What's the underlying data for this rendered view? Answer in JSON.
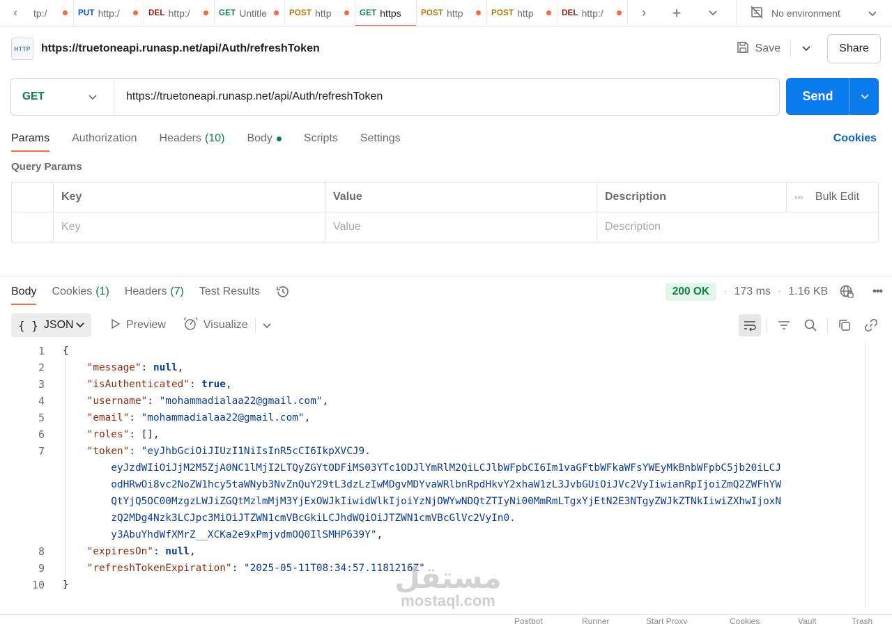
{
  "tabbar": {
    "tabs": [
      {
        "method": "",
        "title": "tp:/",
        "active": false
      },
      {
        "method": "PUT",
        "title": "http:/",
        "active": false
      },
      {
        "method": "DEL",
        "title": "http:/",
        "active": false
      },
      {
        "method": "GET",
        "title": "Untitle",
        "active": false
      },
      {
        "method": "POST",
        "title": "http",
        "active": false
      },
      {
        "method": "GET",
        "title": "https",
        "active": true
      },
      {
        "method": "POST",
        "title": "http",
        "active": false
      },
      {
        "method": "POST",
        "title": "http",
        "active": false
      },
      {
        "method": "DEL",
        "title": "http:/",
        "active": false
      }
    ],
    "environment": "No environment"
  },
  "request": {
    "title": "https://truetoneapi.runasp.net/api/Auth/refreshToken",
    "badge": "HTTP",
    "save_label": "Save",
    "share_label": "Share",
    "method": "GET",
    "url": "https://truetoneapi.runasp.net/api/Auth/refreshToken",
    "send_label": "Send",
    "tabs": {
      "params": "Params",
      "authorization": "Authorization",
      "headers": "Headers",
      "headers_count": "(10)",
      "body": "Body",
      "scripts": "Scripts",
      "settings": "Settings"
    },
    "cookies_label": "Cookies"
  },
  "query_params": {
    "title": "Query Params",
    "headers": {
      "key": "Key",
      "value": "Value",
      "description": "Description",
      "bulk_edit": "Bulk Edit"
    },
    "placeholders": {
      "key": "Key",
      "value": "Value",
      "description": "Description"
    }
  },
  "response": {
    "tabs": {
      "body": "Body",
      "cookies": "Cookies",
      "cookies_count": "(1)",
      "headers": "Headers",
      "headers_count": "(7)",
      "test_results": "Test Results"
    },
    "status": "200 OK",
    "time": "173 ms",
    "size": "1.16 KB",
    "format": "JSON",
    "preview_label": "Preview",
    "visualize_label": "Visualize",
    "lines": [
      {
        "n": "1",
        "parts": [
          [
            "pun",
            "{"
          ]
        ]
      },
      {
        "n": "2",
        "parts": [
          [
            "pun",
            "    "
          ],
          [
            "key",
            "\"message\""
          ],
          [
            "pun",
            ": "
          ],
          [
            "lit",
            "null"
          ],
          [
            "pun",
            ","
          ]
        ]
      },
      {
        "n": "3",
        "parts": [
          [
            "pun",
            "    "
          ],
          [
            "key",
            "\"isAuthenticated\""
          ],
          [
            "pun",
            ": "
          ],
          [
            "lit",
            "true"
          ],
          [
            "pun",
            ","
          ]
        ]
      },
      {
        "n": "4",
        "parts": [
          [
            "pun",
            "    "
          ],
          [
            "key",
            "\"username\""
          ],
          [
            "pun",
            ": "
          ],
          [
            "str",
            "\"mohammadialaa22@gmail.com\""
          ],
          [
            "pun",
            ","
          ]
        ]
      },
      {
        "n": "5",
        "parts": [
          [
            "pun",
            "    "
          ],
          [
            "key",
            "\"email\""
          ],
          [
            "pun",
            ": "
          ],
          [
            "str",
            "\"mohammadialaa22@gmail.com\""
          ],
          [
            "pun",
            ","
          ]
        ]
      },
      {
        "n": "6",
        "parts": [
          [
            "pun",
            "    "
          ],
          [
            "key",
            "\"roles\""
          ],
          [
            "pun",
            ": [],"
          ]
        ]
      },
      {
        "n": "7",
        "parts": [
          [
            "pun",
            "    "
          ],
          [
            "key",
            "\"token\""
          ],
          [
            "pun",
            ": "
          ],
          [
            "str",
            "\"eyJhbGciOiJIUzI1NiIsInR5cCI6IkpXVCJ9."
          ]
        ]
      },
      {
        "n": "",
        "parts": [
          [
            "str",
            "        eyJzdWIiOiJjM2M5ZjA0NC1lMjI2LTQyZGYtODFiMS03YTc1ODJlYmRlM2QiLCJlbWFpbCI6Im1vaGFtbWFkaWFsYWEyMkBnbWFpbC5jb20iLCJ"
          ]
        ]
      },
      {
        "n": "",
        "parts": [
          [
            "str",
            "        odHRwOi8vc2NoZW1hcy5taWNyb3NvZnQuY29tL3dzLzIwMDgvMDYvaWRlbnRpdHkvY2xhaW1zL3JvbGUiOiJVc2VyIiwianRpIjoiZmQ2ZWFhYW"
          ]
        ]
      },
      {
        "n": "",
        "parts": [
          [
            "str",
            "        QtYjQ5OC00MzgzLWJiZGQtMzlmMjM3YjExOWJkIiwidWlkIjoiYzNjOWYwNDQtZTIyNi00MmRmLTgxYjEtN2E3NTgyZWJkZTNkIiwiZXhwIjoxN"
          ]
        ]
      },
      {
        "n": "",
        "parts": [
          [
            "str",
            "        zQ2MDg4Nzk3LCJpc3MiOiJTZWN1cmVBcGkiLCJhdWQiOiJTZWN1cmVBcGlVc2VyIn0."
          ]
        ]
      },
      {
        "n": "",
        "parts": [
          [
            "str",
            "        y3AbuYhdWfXMrZ__XCKa2e9xPmjvdmOQ0IlSMHP639Y\""
          ],
          [
            "pun",
            ","
          ]
        ]
      },
      {
        "n": "8",
        "parts": [
          [
            "pun",
            "    "
          ],
          [
            "key",
            "\"expiresOn\""
          ],
          [
            "pun",
            ": "
          ],
          [
            "lit",
            "null"
          ],
          [
            "pun",
            ","
          ]
        ]
      },
      {
        "n": "9",
        "parts": [
          [
            "pun",
            "    "
          ],
          [
            "key",
            "\"refreshTokenExpiration\""
          ],
          [
            "pun",
            ": "
          ],
          [
            "str",
            "\"2025-05-11T08:34:57.1181216Z\""
          ]
        ]
      },
      {
        "n": "10",
        "parts": [
          [
            "pun",
            "}"
          ]
        ]
      }
    ]
  },
  "watermark": {
    "arabic": "مستقل",
    "latin": "mostaql.com"
  },
  "footer": {
    "items": [
      "Postbot",
      "Runner",
      "Start Proxy",
      "Cookies",
      "Vault",
      "Trash"
    ]
  },
  "colors": {
    "accent": "#ff6c37",
    "send": "#097bed",
    "get": "#0b8043",
    "post": "#ad7a03",
    "put": "#0053b8",
    "delete": "#8e1a10",
    "unsaved_dot": "#f26b3a"
  }
}
